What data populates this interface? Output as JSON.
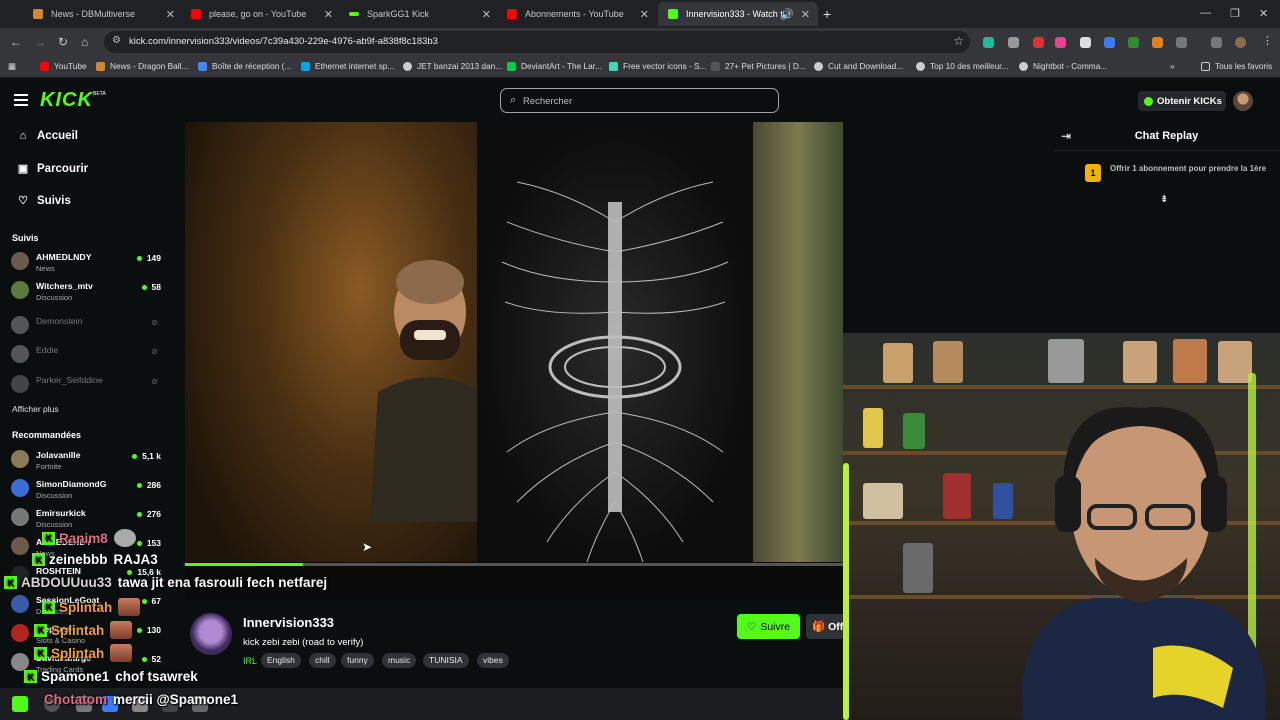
{
  "tabs": [
    {
      "title": "News - DBMultiverse",
      "icon": "dbmultiverse-icon",
      "color": "#d08a2c"
    },
    {
      "title": "please, go on - YouTube",
      "icon": "youtube-icon",
      "color": "#ff0000"
    },
    {
      "title": "SparkGG1 Kick",
      "icon": "kick-icon",
      "color": "#53fc18"
    },
    {
      "title": "Abonnements - YouTube",
      "icon": "youtube-icon",
      "color": "#ff0000"
    },
    {
      "title": "Innervision333 - Watch the",
      "icon": "kick-icon",
      "color": "#53fc18",
      "active": true
    }
  ],
  "address": {
    "url": "kick.com/innervision333/videos/7c39a430-229e-4976-ab9f-a838f8c183b3"
  },
  "bookmarks": [
    {
      "label": "YouTube",
      "color": "#ff0000"
    },
    {
      "label": "News - Dragon Ball...",
      "color": "#d08a2c"
    },
    {
      "label": "Boîte de réception (...",
      "color": "#4285f4"
    },
    {
      "label": "Ethernet internet sp...",
      "color": "#00a4ef"
    },
    {
      "label": "JET banzai 2013 dan...",
      "color": "#cccccc"
    },
    {
      "label": "DeviantArt - The Lar...",
      "color": "#05cc47"
    },
    {
      "label": "Free vector icons - S...",
      "color": "#44d7b6"
    },
    {
      "label": "27+ Pet Pictures | D...",
      "color": "#333333"
    },
    {
      "label": "Cut and Download...",
      "color": "#cccccc"
    },
    {
      "label": "Top 10 des meilleur...",
      "color": "#cccccc"
    },
    {
      "label": "Nightbot - Comma...",
      "color": "#cccccc"
    }
  ],
  "all_bookmarks": "Tous les favoris",
  "kick": {
    "logo": "KICK",
    "beta": "BETA",
    "search_placeholder": "Rechercher",
    "get_kicks": "Obtenir KICKs",
    "brand_color": "#53fc18"
  },
  "nav": [
    {
      "label": "Accueil",
      "icon": "home-icon"
    },
    {
      "label": "Parcourir",
      "icon": "browse-icon"
    },
    {
      "label": "Suivis",
      "icon": "heart-icon"
    }
  ],
  "followed_title": "Suivis",
  "followed": [
    {
      "name": "AHMEDLNDY",
      "category": "News",
      "viewers": "149",
      "live": true
    },
    {
      "name": "Witchers_mtv",
      "category": "Discussion",
      "viewers": "58",
      "live": true
    },
    {
      "name": "Demonstein",
      "category": "",
      "viewers": "",
      "live": false
    },
    {
      "name": "Eddie",
      "category": "",
      "viewers": "",
      "live": false
    },
    {
      "name": "Parker_Seifddine",
      "category": "",
      "viewers": "",
      "live": false
    }
  ],
  "show_more": "Afficher plus",
  "recommended_title": "Recommandées",
  "recommended": [
    {
      "name": "Jolavanille",
      "category": "Fortnite",
      "viewers": "5,1 k"
    },
    {
      "name": "SimonDiamondG",
      "category": "Discussion",
      "viewers": "286"
    },
    {
      "name": "Emirsurkick",
      "category": "Discussion",
      "viewers": "276"
    },
    {
      "name": "AHMEDLNDY",
      "category": "News",
      "viewers": "153"
    },
    {
      "name": "ROSHTEIN",
      "category": "",
      "viewers": "15,6 k"
    },
    {
      "name": "SessionLeGoat",
      "category": "Discussion",
      "viewers": "67"
    },
    {
      "name": "ttlepsrtah",
      "category": "Slots & Casino",
      "viewers": "130"
    },
    {
      "name": "DavidLafarge",
      "category": "Trading Cards",
      "viewers": "52"
    }
  ],
  "overlay_chat": [
    {
      "user": "Ranim8",
      "message": ""
    },
    {
      "user": "zeinebbb",
      "message": "RAJA3"
    },
    {
      "user": "ABDOUUuu33",
      "message": "tawa jit ena fasrouli fech netfarej"
    },
    {
      "user": "Splintah",
      "message": ""
    },
    {
      "user": "Splintah",
      "message": ""
    },
    {
      "user": "Splintah",
      "message": ""
    },
    {
      "user": "Spamone1",
      "message": "chof tsawrek"
    },
    {
      "user": "Chotatom",
      "message": "mercii @Spamone1"
    }
  ],
  "video": {
    "progress": 0.18
  },
  "stream": {
    "streamer": "Innervision333",
    "title": "kick zebi zebi  (road to verify)",
    "category": "IRL",
    "tags": [
      "English",
      "chill",
      "funny",
      "music",
      "TUNISIA",
      "vibes"
    ],
    "follow_label": "Suivre",
    "gift_label": "Off"
  },
  "chat": {
    "title": "Chat Replay",
    "sub_badge": "1",
    "sub_text": "Offrir 1 abonnement pour prendre la 1ère"
  }
}
